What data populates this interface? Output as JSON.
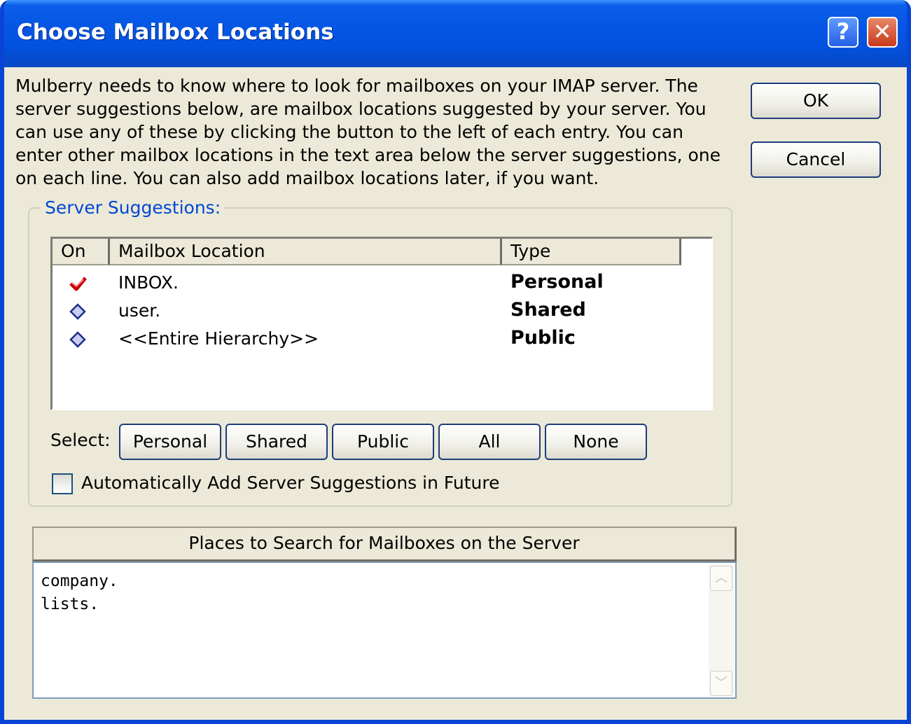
{
  "window": {
    "title": "Choose Mailbox Locations"
  },
  "intro": "Mulberry needs to know where to look for mailboxes on your IMAP server. The server suggestions below, are mailbox locations suggested by your server. You can use any of these by clicking the button to the left of each entry. You can enter other mailbox locations in the text area below the server suggestions, one on each line. You can also add mailbox locations later, if you want.",
  "buttons": {
    "ok": "OK",
    "cancel": "Cancel"
  },
  "suggestions": {
    "group_label": "Server Suggestions:",
    "columns": {
      "on": "On",
      "location": "Mailbox Location",
      "type": "Type"
    },
    "rows": [
      {
        "on": true,
        "location": "INBOX.",
        "type": "Personal"
      },
      {
        "on": false,
        "location": "user.",
        "type": "Shared"
      },
      {
        "on": false,
        "location": "<<Entire Hierarchy>>",
        "type": "Public"
      }
    ],
    "select_label": "Select:",
    "select_buttons": [
      "Personal",
      "Shared",
      "Public",
      "All",
      "None"
    ],
    "auto_add_label": "Automatically Add Server Suggestions in Future",
    "auto_add_checked": false
  },
  "places": {
    "header": "Places to Search for Mailboxes on the Server",
    "lines": [
      "company.",
      "lists."
    ]
  },
  "colors": {
    "titlebar": "#0456e4",
    "group_label": "#0046d5",
    "check": "#c40000",
    "diamond": "#1a2d8c"
  }
}
